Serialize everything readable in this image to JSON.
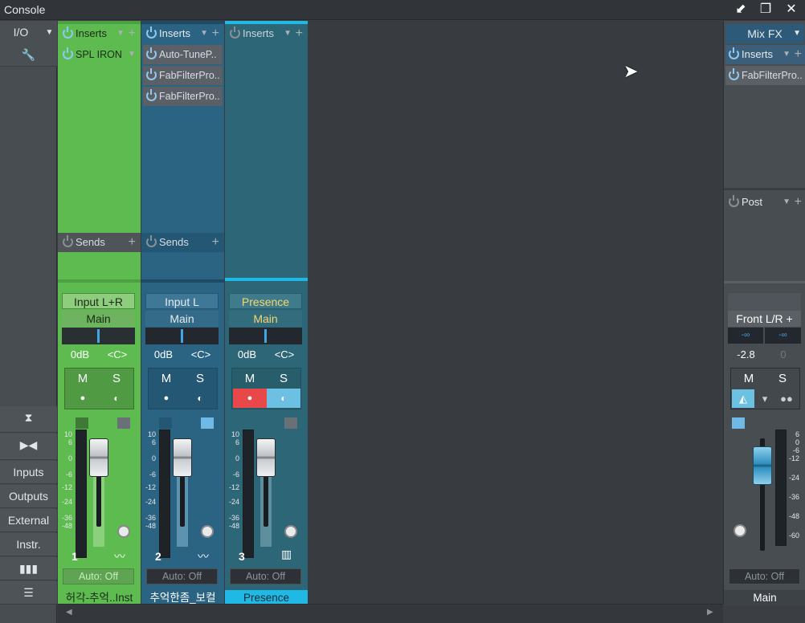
{
  "window": {
    "title": "Console"
  },
  "left_panel": {
    "io_label": "I/O",
    "nav_buttons": [
      "Inputs",
      "Outputs",
      "External",
      "Instr."
    ]
  },
  "colors": {
    "ch1": "#5dbb4f",
    "ch2": "#2b6383",
    "ch3": "#2d6677",
    "ch3_name_bg": "#20b9e6",
    "mute_active": "#e8484a",
    "solo_active": "#6cc0e2"
  },
  "channels": [
    {
      "inserts_label": "Inserts",
      "insert_slots": [
        "SPL IRON"
      ],
      "sends_label": "Sends",
      "input": "Input L+R",
      "output": "Main",
      "volume": "0dB",
      "pan": "<C>",
      "mute": "M",
      "solo": "S",
      "number": "1",
      "scale": [
        "10",
        "6",
        "0",
        "-6",
        "-12",
        "-24",
        "-36",
        "-48"
      ],
      "automation": "Auto: Off",
      "name": "허각-추억..Inst"
    },
    {
      "inserts_label": "Inserts",
      "insert_slots": [
        "Auto-TuneP..",
        "FabFilterPro..",
        "FabFilterPro.."
      ],
      "sends_label": "Sends",
      "input": "Input L",
      "output": "Main",
      "volume": "0dB",
      "pan": "<C>",
      "mute": "M",
      "solo": "S",
      "number": "2",
      "scale": [
        "10",
        "6",
        "0",
        "-6",
        "-12",
        "-24",
        "-36",
        "-48"
      ],
      "automation": "Auto: Off",
      "name": "추억한좀_보컬"
    },
    {
      "inserts_label": "Inserts",
      "insert_slots": [],
      "input": "Presence",
      "output": "Main",
      "volume": "0dB",
      "pan": "<C>",
      "mute": "M",
      "solo": "S",
      "number": "3",
      "scale": [
        "10",
        "6",
        "0",
        "-6",
        "-12",
        "-24",
        "-36",
        "-48"
      ],
      "automation": "Auto: Off",
      "name": "Presence"
    }
  ],
  "main_bus": {
    "section_label": "Mix FX",
    "inserts_label": "Inserts",
    "insert_slots": [
      "FabFilterPro.."
    ],
    "post_label": "Post",
    "output": "Front L/R +",
    "peak_left": "-∞",
    "peak_right": "-∞",
    "volume": "-2.8",
    "pan": "0",
    "mute": "M",
    "solo": "S",
    "scale": [
      "6",
      "0",
      "-6",
      "-12",
      "-24",
      "-36",
      "-48",
      "-60"
    ],
    "automation": "Auto: Off",
    "name": "Main"
  }
}
